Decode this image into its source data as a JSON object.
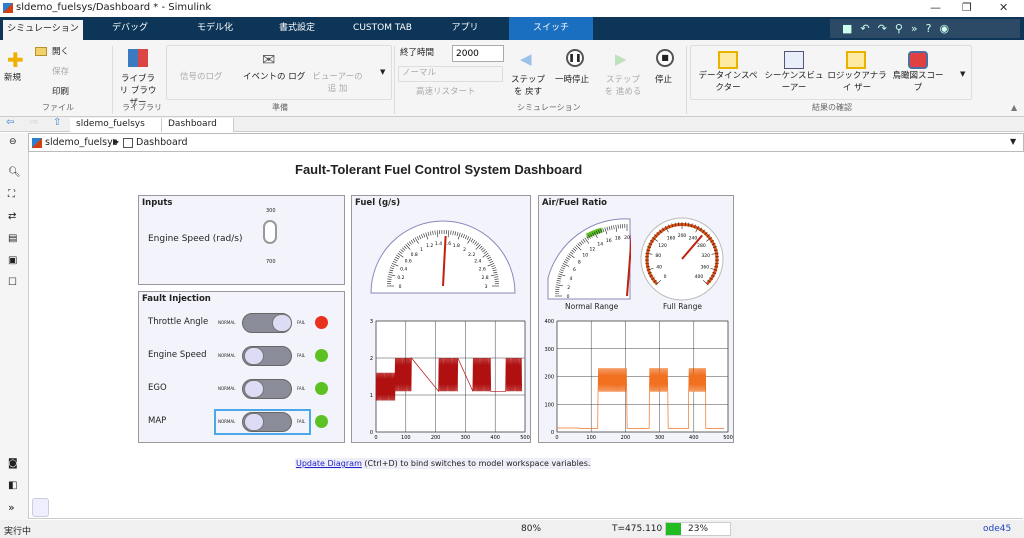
{
  "window": {
    "title": "sldemo_fuelsys/Dashboard * - Simulink",
    "minimize": "—",
    "maximize": "❐",
    "close": "✕"
  },
  "tabs": [
    {
      "label": "シミュレーション"
    },
    {
      "label": "デバッグ"
    },
    {
      "label": "モデル化"
    },
    {
      "label": "書式設定"
    },
    {
      "label": "CUSTOM TAB"
    },
    {
      "label": "アプリ"
    },
    {
      "label": "スイッチ"
    }
  ],
  "ribbon": {
    "file": {
      "new": "新規",
      "open": "開く",
      "save": "保存",
      "print": "印刷",
      "group": "ファイル"
    },
    "library": {
      "browser": "ライブラリ ブラウザー",
      "group": "ライブラリ"
    },
    "prepare": {
      "signal_log": "信号のログ",
      "event_log": "イベントの ログ",
      "add_viewer": "ビューアーの追 加",
      "group": "準備"
    },
    "simulation": {
      "stop_time_label": "終了時間",
      "stop_time": "2000",
      "mode": "ノーマル",
      "fast_restart": "高速リスタート",
      "step_back": "ステップを 戻す",
      "pause": "一時停止",
      "step_forward": "ステップを 進める",
      "stop": "停止",
      "group": "シミュレーション"
    },
    "review": {
      "data_inspector": "データインスペ クター",
      "sequence_viewer": "シーケンスビュ ーアー",
      "logic_analyzer": "ロジックアナライ ザー",
      "birdseye": "鳥瞰図スコー プ",
      "group": "結果の確認"
    }
  },
  "doc_tabs": [
    {
      "label": "sldemo_fuelsys"
    },
    {
      "label": "Dashboard"
    }
  ],
  "breadcrumb": [
    "sldemo_fuelsys",
    "Dashboard"
  ],
  "dashboard": {
    "title": "Fault-Tolerant Fuel Control System Dashboard",
    "inputs": {
      "title": "Inputs",
      "label": "Engine Speed (rad/s)",
      "top": "300",
      "bottom": "700"
    },
    "faults": {
      "title": "Fault Injection",
      "normal": "NORMAL",
      "fail": "FAIL",
      "items": [
        {
          "label": "Throttle Angle",
          "state": "fail",
          "led": "#e8321e"
        },
        {
          "label": "Engine Speed",
          "state": "normal",
          "led": "#5cc223"
        },
        {
          "label": "EGO",
          "state": "normal",
          "led": "#5cc223"
        },
        {
          "label": "MAP",
          "state": "normal",
          "led": "#5cc223"
        }
      ]
    },
    "fuel": {
      "title": "Fuel (g/s)",
      "gauge_value": 1.55,
      "gauge_ticks": [
        "0",
        "0.2",
        "0.4",
        "0.6",
        "0.8",
        "1",
        "1.2",
        "1.4",
        "1.6",
        "1.8",
        "2",
        "2.2",
        "2.4",
        "2.6",
        "2.8",
        "3"
      ]
    },
    "afr": {
      "title": "Air/Fuel Ratio",
      "normal_label": "Normal Range",
      "full_label": "Full Range",
      "normal_ticks": [
        "0",
        "2",
        "4",
        "6",
        "8",
        "10",
        "12",
        "14",
        "16",
        "18",
        "20"
      ],
      "full_ticks": [
        "0",
        "40",
        "80",
        "120",
        "160",
        "200",
        "240",
        "280",
        "320",
        "360",
        "400"
      ],
      "full_value": 260
    }
  },
  "chart_data": [
    {
      "type": "line",
      "name": "fuel-plot",
      "xlim": [
        0,
        500
      ],
      "ylim": [
        0,
        3
      ],
      "xticks": [
        "0",
        "100",
        "200",
        "300",
        "400",
        "500"
      ],
      "yticks": [
        "0",
        "1",
        "2",
        "3"
      ],
      "grid": true,
      "color": "#b01010",
      "bands": [
        {
          "x": [
            0,
            63
          ],
          "y": [
            0.85,
            1.6
          ]
        },
        {
          "x": [
            65,
            120
          ],
          "y": [
            1.1,
            2.0
          ]
        },
        {
          "x": [
            210,
            275
          ],
          "y": [
            1.1,
            2.0
          ]
        },
        {
          "x": [
            325,
            385
          ],
          "y": [
            1.1,
            2.0
          ]
        },
        {
          "x": [
            435,
            490
          ],
          "y": [
            1.1,
            2.0
          ]
        }
      ]
    },
    {
      "type": "line",
      "name": "afr-plot",
      "xlim": [
        0,
        500
      ],
      "ylim": [
        0,
        400
      ],
      "xticks": [
        "0",
        "100",
        "200",
        "300",
        "400",
        "500"
      ],
      "yticks": [
        "0",
        "100",
        "200",
        "300",
        "400"
      ],
      "grid": true,
      "color": "#f07020",
      "bands": [
        {
          "x": [
            0,
            65
          ],
          "y": [
            14.5,
            14.5
          ]
        },
        {
          "x": [
            65,
            120
          ],
          "y": [
            13,
            13
          ]
        },
        {
          "x": [
            120,
            205
          ],
          "y": [
            145,
            230
          ]
        },
        {
          "x": [
            205,
            270
          ],
          "y": [
            13,
            13
          ]
        },
        {
          "x": [
            270,
            325
          ],
          "y": [
            145,
            230
          ]
        },
        {
          "x": [
            325,
            385
          ],
          "y": [
            13,
            13
          ]
        },
        {
          "x": [
            385,
            435
          ],
          "y": [
            145,
            230
          ]
        },
        {
          "x": [
            435,
            490
          ],
          "y": [
            13,
            13
          ]
        }
      ]
    }
  ],
  "hint": {
    "link": "Update Diagram",
    "text": " (Ctrl+D) to bind switches to model workspace variables."
  },
  "status": {
    "state": "実行中",
    "zoom": "80%",
    "time": "T=475.110",
    "progress": 23,
    "progress_label": "23%",
    "solver": "ode45"
  }
}
